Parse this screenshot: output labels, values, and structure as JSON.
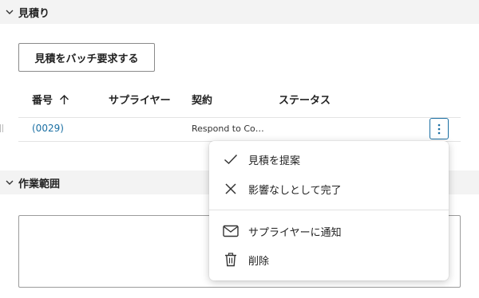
{
  "sections": {
    "quotes": {
      "title": "見積り"
    },
    "scope": {
      "title": "作業範囲"
    }
  },
  "toolbar": {
    "batch_request_label": "見積をバッチ要求する"
  },
  "table": {
    "columns": [
      "番号",
      "サプライヤー",
      "契約",
      "ステータス"
    ],
    "sort": {
      "column": "番号",
      "direction": "ascending"
    },
    "rows": [
      {
        "number": "(0029)",
        "supplier": "",
        "contract": "Respond to Co…",
        "status": ""
      }
    ]
  },
  "context_menu": {
    "items": [
      {
        "label": "見積を提案",
        "icon": "check-icon"
      },
      {
        "label": "影響なしとして完了",
        "icon": "close-icon"
      },
      {
        "label": "サプライヤーに通知",
        "icon": "mail-icon"
      },
      {
        "label": "削除",
        "icon": "trash-icon"
      }
    ]
  },
  "scope_text": {
    "value": ""
  },
  "colors": {
    "accent": "#1a6fa3",
    "header_bg": "#f3f3f3"
  }
}
